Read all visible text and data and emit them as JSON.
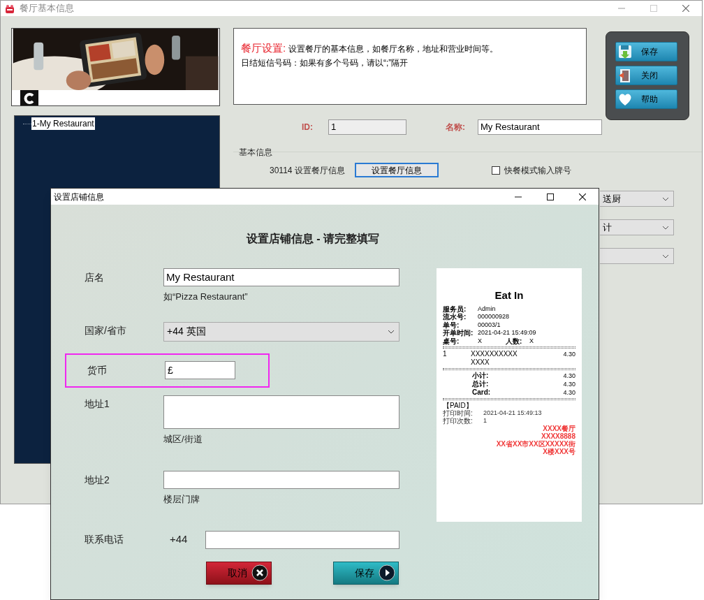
{
  "main_window": {
    "title": "餐厅基本信息",
    "tree": [
      {
        "label": "1-My Restaurant",
        "selected": true
      }
    ],
    "info": {
      "title": "餐厅设置:",
      "lines": [
        "设置餐厅的基本信息，如餐厅名称，地址和营业时间等。",
        "日结短信号码：如果有多个号码，请以“;”隔开"
      ]
    },
    "side_buttons": [
      {
        "label": "保存"
      },
      {
        "label": "关闭"
      },
      {
        "label": "帮助"
      }
    ],
    "id_field": {
      "label": "ID:",
      "value": "1"
    },
    "name_field": {
      "label": "名称:",
      "value": "My Restaurant"
    },
    "section_title": "基本信息",
    "setting_label": "30114 设置餐厅信息",
    "setting_button": "设置餐厅信息",
    "quick_mode": {
      "label": "快餐模式输入牌号",
      "checked": false
    },
    "dropdowns": [
      {
        "kind": "select",
        "value": "送厨"
      },
      {
        "kind": "select",
        "value": "计"
      },
      {
        "kind": "select"
      }
    ]
  },
  "dialog": {
    "title": "设置店铺信息",
    "heading": "设置店铺信息 - 请完整填写",
    "fields": [
      {
        "kind": "text",
        "label": "店名",
        "value": "My Restaurant",
        "hint": "如“Pizza Restaurant”",
        "highlighted": false
      },
      {
        "kind": "select",
        "label": "国家/省市",
        "value": "+44 英国",
        "highlighted": false
      },
      {
        "kind": "short",
        "label": "货币",
        "value": "£",
        "highlighted": true
      },
      {
        "kind": "area",
        "label": "地址1",
        "hint": "城区/街道",
        "highlighted": false
      },
      {
        "kind": "text",
        "label": "地址2",
        "hint": "楼层门牌",
        "highlighted": false
      },
      {
        "kind": "phone",
        "label": "联系电话",
        "prefix": "+44",
        "highlighted": false
      }
    ],
    "buttons": [
      {
        "label": "取消",
        "kind": "cancel"
      },
      {
        "label": "保存",
        "kind": "save"
      }
    ],
    "receipt": {
      "title": "Eat In",
      "info": [
        {
          "label": "服务员:",
          "value": "Admin"
        },
        {
          "label": "流水号:",
          "value": "000000928"
        },
        {
          "label": "单号:",
          "value": "00003/1"
        },
        {
          "label": "开单时间:",
          "value": "2021-04-21 15:49:09"
        }
      ],
      "table": {
        "label": "桌号:",
        "value": "X",
        "guests_label": "人数:",
        "guests": "X"
      },
      "items": [
        {
          "qty": "1",
          "name": "XXXXXXXXXX XXXX",
          "price": "4.30"
        }
      ],
      "totals": [
        {
          "label": "小计:",
          "value": "4.30"
        },
        {
          "label": "总计:",
          "value": "4.30"
        },
        {
          "label": "Card:",
          "value": "4.30"
        }
      ],
      "status": "【PAID】",
      "print_info": [
        {
          "label": "打印时间:",
          "value": "2021-04-21 15:49:13"
        },
        {
          "label": "打印次数:",
          "value": "1"
        }
      ],
      "footer": [
        "XXXX餐厅",
        "XXXX8888",
        "XX省XX市XX区XXXXX街",
        "X楼XXX号"
      ]
    }
  }
}
